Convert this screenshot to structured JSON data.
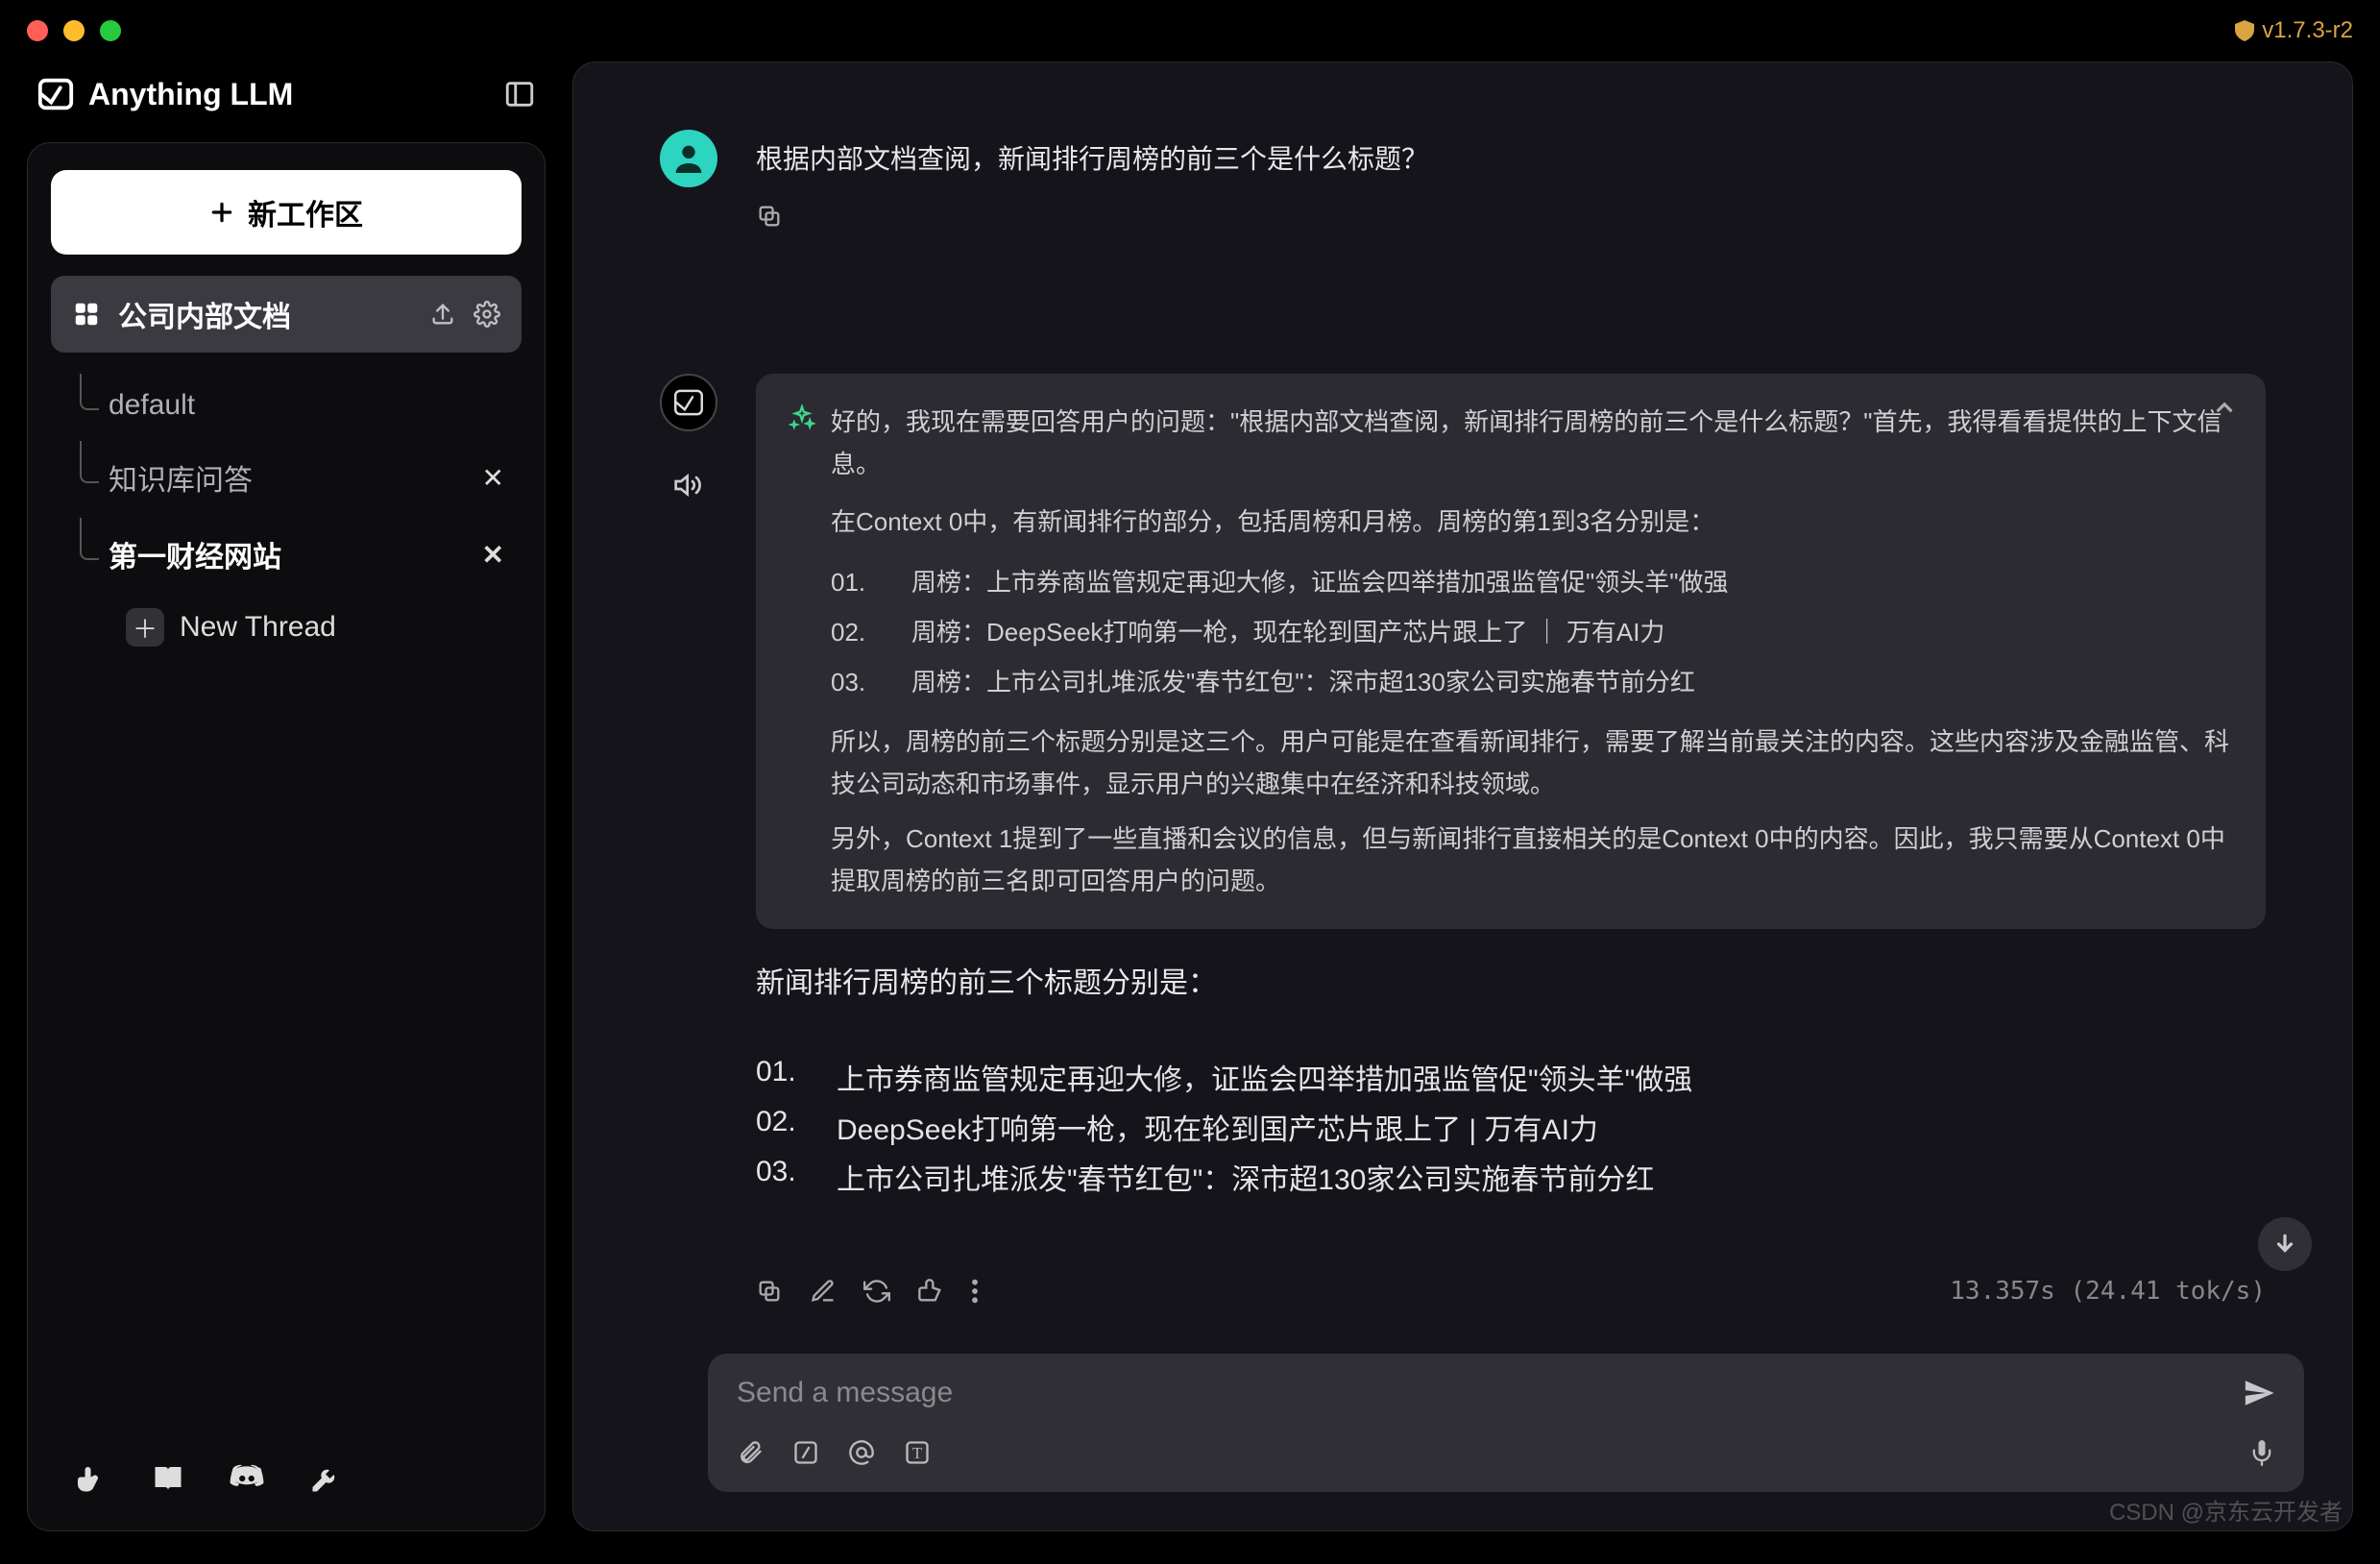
{
  "app": {
    "name": "Anything LLM",
    "version": "v1.7.3-r2"
  },
  "sidebar": {
    "new_workspace_label": "新工作区",
    "workspace": {
      "name": "公司内部文档"
    },
    "threads": [
      {
        "label": "default",
        "closable": false,
        "active": false
      },
      {
        "label": "知识库问答",
        "closable": true,
        "active": false
      },
      {
        "label": "第一财经网站",
        "closable": true,
        "active": true
      }
    ],
    "new_thread_label": "New Thread"
  },
  "chat": {
    "user_message": "根据内部文档查阅，新闻排行周榜的前三个是什么标题？",
    "reasoning": {
      "intro1": "好的，我现在需要回答用户的问题：\"根据内部文档查阅，新闻排行周榜的前三个是什么标题？\"首先，我得看看提供的上下文信息。",
      "intro2": "在Context 0中，有新闻排行的部分，包括周榜和月榜。周榜的第1到3名分别是：",
      "items": [
        {
          "n": "01.",
          "text": "周榜：上市券商监管规定再迎大修，证监会四举措加强监管促\"领头羊\"做强"
        },
        {
          "n": "02.",
          "text": "周榜：DeepSeek打响第一枪，现在轮到国产芯片跟上了 ｜ 万有AI力"
        },
        {
          "n": "03.",
          "text": "周榜：上市公司扎堆派发\"春节红包\"：深市超130家公司实施春节前分红"
        }
      ],
      "outro1": "所以，周榜的前三个标题分别是这三个。用户可能是在查看新闻排行，需要了解当前最关注的内容。这些内容涉及金融监管、科技公司动态和市场事件，显示用户的兴趣集中在经济和科技领域。",
      "outro2": "另外，Context 1提到了一些直播和会议的信息，但与新闻排行直接相关的是Context 0中的内容。因此，我只需要从Context 0中提取周榜的前三名即可回答用户的问题。"
    },
    "answer": {
      "lead": "新闻排行周榜的前三个标题分别是：",
      "items": [
        {
          "n": "01.",
          "text": "上市券商监管规定再迎大修，证监会四举措加强监管促\"领头羊\"做强"
        },
        {
          "n": "02.",
          "text": "DeepSeek打响第一枪，现在轮到国产芯片跟上了 | 万有AI力"
        },
        {
          "n": "03.",
          "text": "上市公司扎堆派发\"春节红包\"：深市超130家公司实施春节前分红"
        }
      ]
    },
    "stats": "13.357s (24.41 tok/s)"
  },
  "composer": {
    "placeholder": "Send a message"
  },
  "watermark": "CSDN @京东云开发者"
}
